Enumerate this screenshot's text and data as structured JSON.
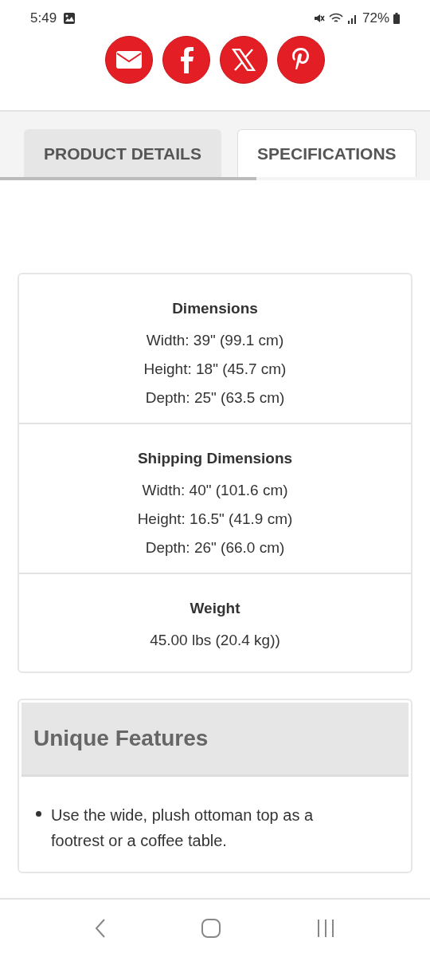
{
  "status_bar": {
    "time": "5:49",
    "battery": "72%"
  },
  "share_buttons": [
    {
      "kind": "email"
    },
    {
      "kind": "facebook"
    },
    {
      "kind": "x"
    },
    {
      "kind": "pinterest"
    }
  ],
  "tabs": [
    {
      "label": "PRODUCT DETAILS",
      "selected": false
    },
    {
      "label": "SPECIFICATIONS",
      "selected": true
    }
  ],
  "spec_sections": [
    {
      "title": "Dimensions",
      "lines": [
        "Width: 39\" (99.1 cm)",
        "Height: 18\" (45.7 cm)",
        "Depth: 25\" (63.5 cm)"
      ]
    },
    {
      "title": "Shipping Dimensions",
      "lines": [
        "Width: 40\" (101.6 cm)",
        "Height: 16.5\" (41.9 cm)",
        "Depth: 26\" (66.0 cm)"
      ]
    },
    {
      "title": "Weight",
      "lines": [
        "45.00 lbs (20.4 kg))"
      ]
    }
  ],
  "features": {
    "title": "Unique Features",
    "items": [
      "Use the wide, plush ottoman top as a footrest or a coffee table."
    ]
  }
}
